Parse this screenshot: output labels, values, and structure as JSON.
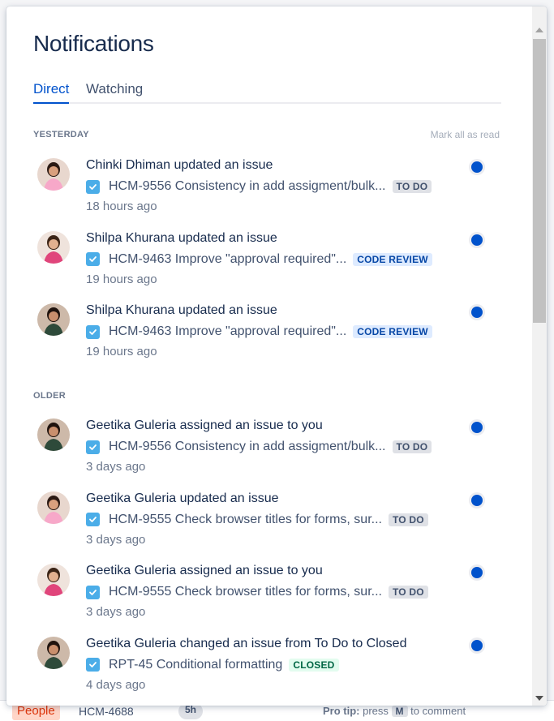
{
  "panel": {
    "title": "Notifications",
    "tabs": [
      {
        "label": "Direct",
        "active": true
      },
      {
        "label": "Watching",
        "active": false
      }
    ],
    "mark_all_label": "Mark all as read"
  },
  "sections": [
    {
      "label": "YESTERDAY",
      "items": [
        {
          "actor": "Chinki Dhiman updated an issue",
          "issue": "HCM-9556 Consistency in add assigment/bulk...",
          "status": "TO DO",
          "status_kind": "todo",
          "time": "18 hours ago",
          "unread": true
        },
        {
          "actor": "Shilpa Khurana updated an issue",
          "issue": "HCM-9463 Improve \"approval required\"...",
          "status": "CODE REVIEW",
          "status_kind": "review",
          "time": "19 hours ago",
          "unread": true
        },
        {
          "actor": "Shilpa Khurana updated an issue",
          "issue": "HCM-9463 Improve \"approval required\"...",
          "status": "CODE REVIEW",
          "status_kind": "review",
          "time": "19 hours ago",
          "unread": true
        }
      ]
    },
    {
      "label": "OLDER",
      "items": [
        {
          "actor": "Geetika Guleria assigned an issue to you",
          "issue": "HCM-9556 Consistency in add assigment/bulk...",
          "status": "TO DO",
          "status_kind": "todo",
          "time": "3 days ago",
          "unread": true
        },
        {
          "actor": "Geetika Guleria updated an issue",
          "issue": "HCM-9555 Check browser titles for forms, sur...",
          "status": "TO DO",
          "status_kind": "todo",
          "time": "3 days ago",
          "unread": true
        },
        {
          "actor": "Geetika Guleria assigned an issue to you",
          "issue": "HCM-9555 Check browser titles for forms, sur...",
          "status": "TO DO",
          "status_kind": "todo",
          "time": "3 days ago",
          "unread": true
        },
        {
          "actor": "Geetika Guleria changed an issue from To Do to Closed",
          "issue": "RPT-45 Conditional formatting",
          "status": "CLOSED",
          "status_kind": "closed",
          "time": "4 days ago",
          "unread": true
        }
      ]
    }
  ],
  "background": {
    "people_chip": "People",
    "issue_key": "HCM-4688",
    "time_chip": "5h",
    "tip_bold": "Pro tip:",
    "tip_pre": "press",
    "tip_key": "M",
    "tip_post": "to comment"
  },
  "colors": {
    "accent": "#0052cc",
    "issue_icon": "#4bade8",
    "unread_dot": "#0052cc"
  },
  "icons": {
    "issue_type": "checkbox-icon",
    "avatar": "avatar-icon"
  }
}
